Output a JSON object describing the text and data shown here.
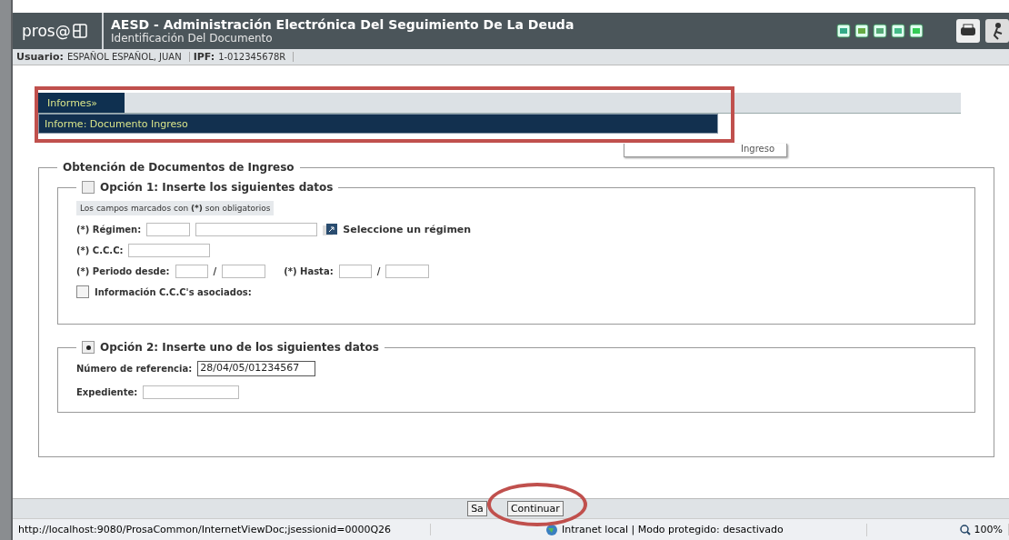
{
  "header": {
    "logo": "pros@",
    "title": "AESD - Administración Electrónica Del Seguimiento De La Deuda",
    "subtitle": "Identificación Del Documento"
  },
  "user_bar": [
    {
      "label": "Usuario:",
      "value": "ESPAÑOL ESPAÑOL, JUAN"
    },
    {
      "label": "IPF:",
      "value": "1-012345678R"
    }
  ],
  "menu": {
    "tabs": [
      {
        "label": "Informes»",
        "selected": true
      }
    ],
    "dropdown": [
      {
        "label": "Informe: Documento Ingreso",
        "selected": true
      }
    ],
    "tooltip": "Ingreso"
  },
  "form": {
    "legend": "Obtención de Documentos de Ingreso",
    "option1": {
      "legend": "Opción 1: Inserte los siguientes datos",
      "selected": false,
      "note": "Los campos marcados con **(*)** son obligatorios",
      "regimen_label": "(*) Régimen:",
      "regimen_link": "Seleccione un régimen",
      "ccc_label": "(*) C.C.C:",
      "desde_label": "(*) Periodo desde:",
      "slash": "/",
      "hasta_label": "(*) Hasta:",
      "asociados": {
        "label": "Información C.C.C's asociados:",
        "checked": false
      }
    },
    "option2": {
      "legend": "Opción 2: Inserte uno de los siguientes datos",
      "selected": true,
      "referencia_label": "Número de referencia:",
      "referencia_value": "28/04/05/01234567",
      "expediente_label": "Expediente:"
    }
  },
  "buttons": [
    "Sa",
    "Continuar"
  ],
  "status_bar": {
    "url": "http://localhost:9080/ProsaCommon/InternetViewDoc;jsessionid=0000Q26",
    "zone": "Intranet local | Modo protegido: desactivado",
    "zoom": "100%"
  }
}
